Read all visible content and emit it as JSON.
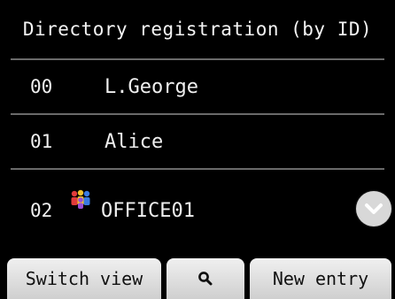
{
  "header": {
    "title": "Directory registration (by ID)"
  },
  "entries": [
    {
      "id": "00",
      "name": "L.George",
      "group": false
    },
    {
      "id": "01",
      "name": "Alice",
      "group": false
    },
    {
      "id": "02",
      "name": "OFFICE01",
      "group": true
    }
  ],
  "icons": {
    "scroll": "chevron-down-icon",
    "search": "search-icon",
    "group": "group-icon"
  },
  "footer": {
    "switch_view_label": "Switch view",
    "new_entry_label": "New entry"
  },
  "colors": {
    "background": "#000000",
    "divider": "#6a6a6a",
    "button": "#e2e2e2"
  }
}
